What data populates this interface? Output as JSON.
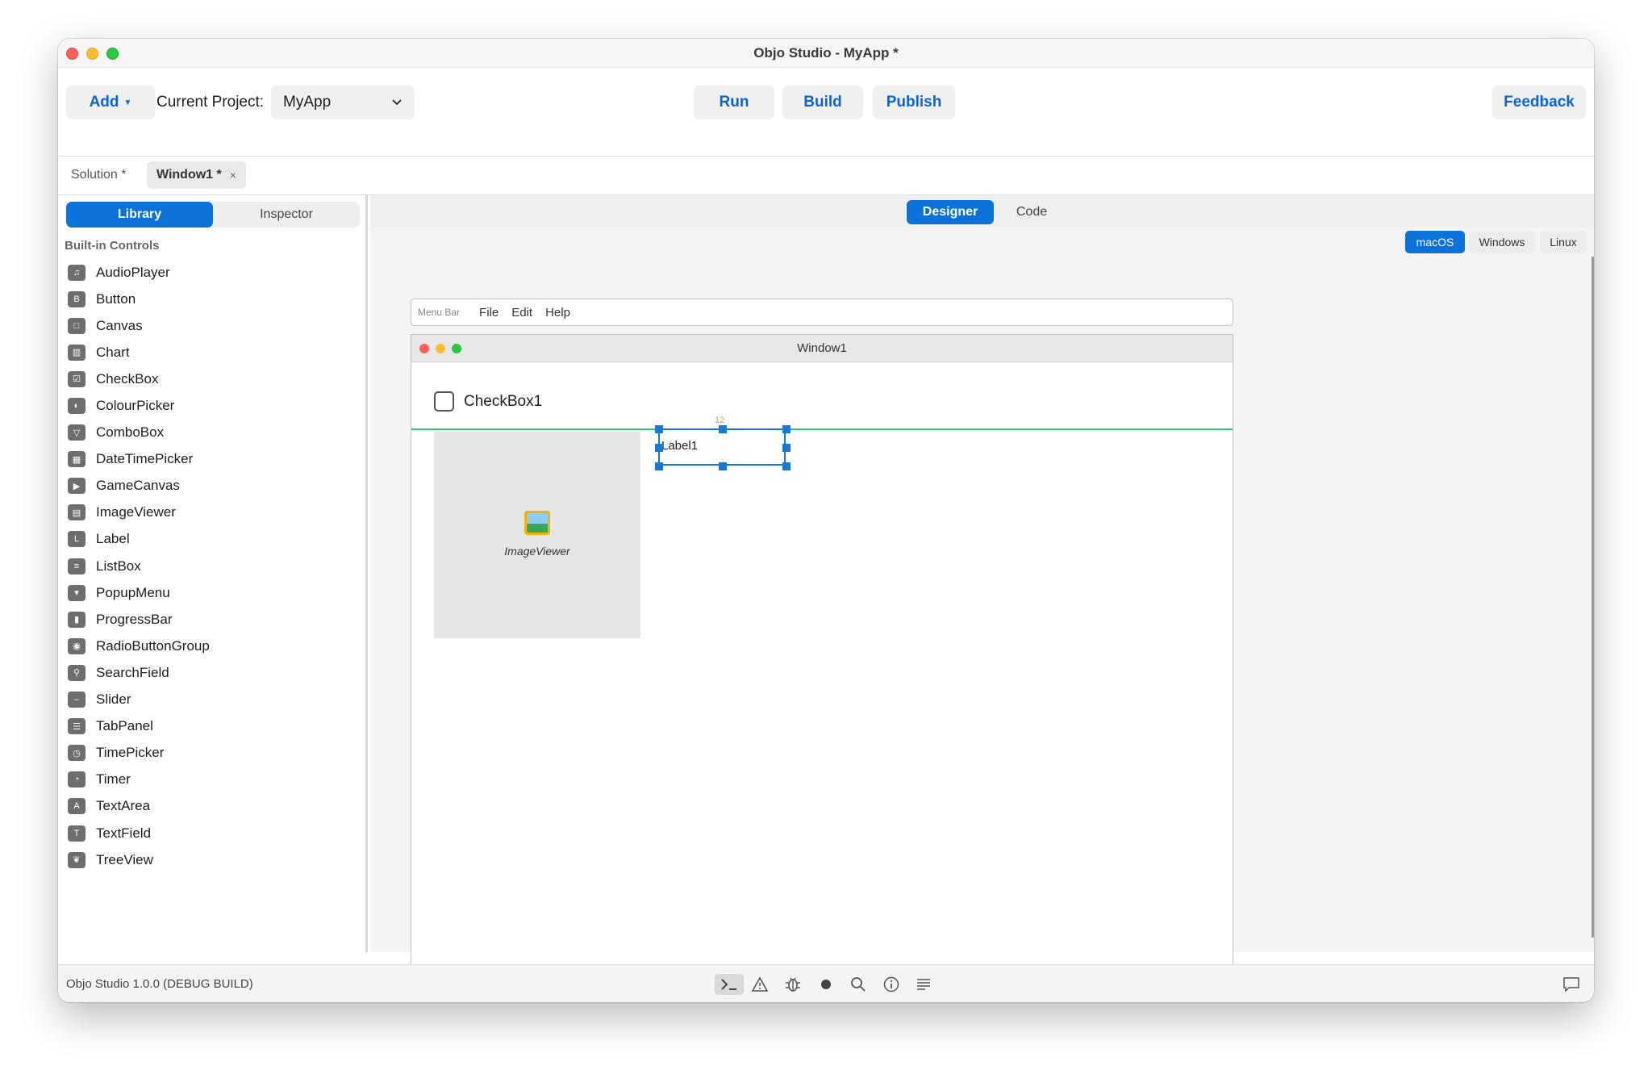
{
  "window": {
    "title": "Objo Studio - MyApp *"
  },
  "toolbar": {
    "add_label": "Add",
    "current_project_label": "Current Project:",
    "project_value": "MyApp",
    "run_label": "Run",
    "build_label": "Build",
    "publish_label": "Publish",
    "feedback_label": "Feedback"
  },
  "doc_tabs": [
    {
      "label": "Solution *",
      "active": false
    },
    {
      "label": "Window1 *",
      "active": true,
      "close": "×"
    }
  ],
  "sidebar": {
    "tabs": [
      "Library",
      "Inspector"
    ],
    "active_tab": "Library",
    "section_title": "Built-in Controls",
    "controls": [
      {
        "label": "AudioPlayer",
        "icon": "♫"
      },
      {
        "label": "Button",
        "icon": "B"
      },
      {
        "label": "Canvas",
        "icon": "□"
      },
      {
        "label": "Chart",
        "icon": "▥"
      },
      {
        "label": "CheckBox",
        "icon": "☑"
      },
      {
        "label": "ColourPicker",
        "icon": "◐"
      },
      {
        "label": "ComboBox",
        "icon": "▽"
      },
      {
        "label": "DateTimePicker",
        "icon": "▦"
      },
      {
        "label": "GameCanvas",
        "icon": "▶"
      },
      {
        "label": "ImageViewer",
        "icon": "▤"
      },
      {
        "label": "Label",
        "icon": "L"
      },
      {
        "label": "ListBox",
        "icon": "≡"
      },
      {
        "label": "PopupMenu",
        "icon": "▾"
      },
      {
        "label": "ProgressBar",
        "icon": "▮"
      },
      {
        "label": "RadioButtonGroup",
        "icon": "◉"
      },
      {
        "label": "SearchField",
        "icon": "⚲"
      },
      {
        "label": "Slider",
        "icon": "–"
      },
      {
        "label": "TabPanel",
        "icon": "☰"
      },
      {
        "label": "TimePicker",
        "icon": "◷"
      },
      {
        "label": "Timer",
        "icon": "◔"
      },
      {
        "label": "TextArea",
        "icon": "A"
      },
      {
        "label": "TextField",
        "icon": "T"
      },
      {
        "label": "TreeView",
        "icon": "❦"
      }
    ]
  },
  "main": {
    "mode_tabs": [
      "Designer",
      "Code"
    ],
    "active_mode": "Designer",
    "os_tabs": [
      "macOS",
      "Windows",
      "Linux"
    ],
    "active_os": "macOS"
  },
  "designer": {
    "menubar": {
      "label": "Menu Bar",
      "items": [
        "File",
        "Edit",
        "Help"
      ]
    },
    "form_title": "Window1",
    "checkbox_label": "CheckBox1",
    "imageviewer_label": "ImageViewer",
    "label_text": "Label1",
    "spacing_readout": "12"
  },
  "statusbar": {
    "text": "Objo Studio 1.0.0 (DEBUG BUILD)",
    "icons": [
      "terminal-icon",
      "warning-icon",
      "bug-icon",
      "record-icon",
      "search-icon",
      "info-icon",
      "list-icon",
      "chat-icon"
    ]
  },
  "colors": {
    "accent": "#0a72d8",
    "link": "#0a64d6",
    "guide": "#34c77b"
  }
}
